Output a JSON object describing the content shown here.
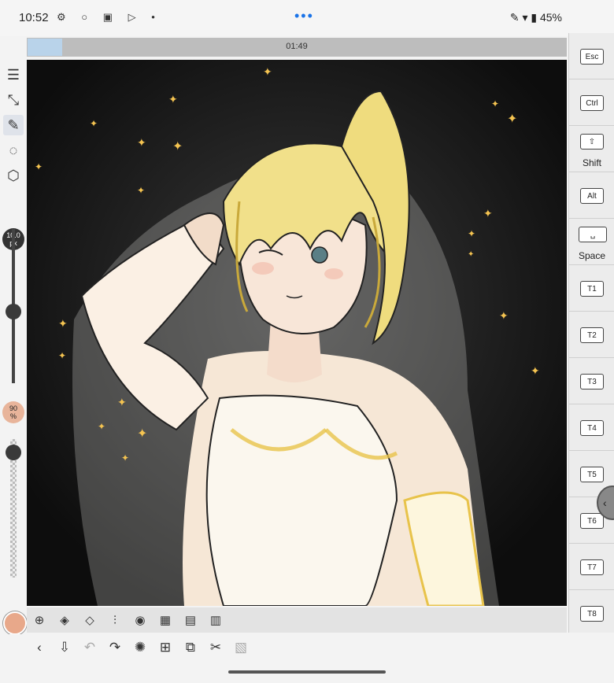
{
  "status_bar": {
    "time": "10:52",
    "left_icons": "⚙ ○ ▣ ▷ •",
    "dots": "•••",
    "battery": "45%"
  },
  "timeline": {
    "time_label": "01:49",
    "progress_fraction": 0.064
  },
  "left_toolbar": {
    "brush_size_value": "10.0",
    "brush_size_unit": "px",
    "opacity_value": "90",
    "opacity_unit": "%",
    "size_slider_fraction": 0.46,
    "opacity_slider_fraction": 0.95,
    "current_color": "#e8a88a"
  },
  "right_panel": {
    "keys": [
      {
        "cap": "Esc",
        "sub": ""
      },
      {
        "cap": "Ctrl",
        "sub": ""
      },
      {
        "cap": "⇧",
        "sub": "Shift"
      },
      {
        "cap": "Alt",
        "sub": ""
      },
      {
        "cap": "␣",
        "sub": "Space"
      },
      {
        "cap": "T1",
        "sub": ""
      },
      {
        "cap": "T2",
        "sub": ""
      },
      {
        "cap": "T3",
        "sub": ""
      },
      {
        "cap": "T4",
        "sub": ""
      },
      {
        "cap": "T5",
        "sub": ""
      },
      {
        "cap": "T6",
        "sub": ""
      },
      {
        "cap": "T7",
        "sub": ""
      },
      {
        "cap": "T8",
        "sub": ""
      }
    ]
  },
  "icons": {
    "menu": "☰",
    "transform": "⤡",
    "pen": "✎",
    "lasso": "◌",
    "cube": "⬡",
    "cursor": "⊕",
    "layers": "◈",
    "layer_props": "◇",
    "adjust": "⫶",
    "filter": "◉",
    "grid": "▦",
    "film": "▤",
    "calendar": "▥",
    "back": "‹",
    "import": "⇩",
    "undo": "↶",
    "redo": "↷",
    "spinner": "✺",
    "crop": "⊞",
    "copy": "⧉",
    "cut": "✂",
    "paste": "▧",
    "plus": "+"
  }
}
